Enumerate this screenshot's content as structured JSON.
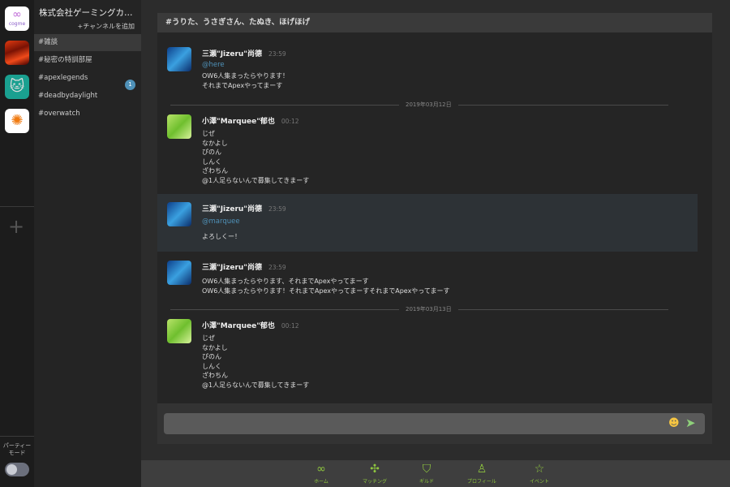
{
  "guild": {
    "name": "株式会社ゲーミングカ…",
    "add_channel": "+チャンネルを追加"
  },
  "channels": [
    {
      "label": "#雑談",
      "active": true
    },
    {
      "label": "#秘密の特訓部屋"
    },
    {
      "label": "#apexlegends",
      "badge": "1"
    },
    {
      "label": "#deadbydaylight"
    },
    {
      "label": "#overwatch"
    }
  ],
  "servers": [
    "cogme",
    "fire",
    "cat",
    "flower"
  ],
  "server_logo_text": "cogme",
  "party_mode": {
    "label": "パーティー\nモード",
    "on": false
  },
  "chat": {
    "title": "#うりた、うさぎさん、たぬき、ほげほげ",
    "messages": [
      {
        "author": "三瀬\"Jizeru\"尚德",
        "time": "23:59",
        "mention": "@here",
        "text": "OW6人集まったらやります！\nそれまでApexやってまーす"
      },
      {
        "date": "2019年03月12日"
      },
      {
        "author": "小澤\"Marquee\"郁也",
        "time": "00:12",
        "text": "じぜ\nなかよし\nぴのん\nしんく\nざわちん\n@1人足らないんで募集してきまーす"
      },
      {
        "author": "三瀬\"Jizeru\"尚德",
        "time": "23:59",
        "mention": "@marquee",
        "text": "よろしくー！",
        "highlighted": true
      },
      {
        "author": "三瀬\"Jizeru\"尚德",
        "time": "23:59",
        "text": "OW6人集まったらやります、それまでApexやってまーす\nOW6人集まったらやります！それまでApexやってまーすそれまでApexやってまーす"
      },
      {
        "date": "2019年03月13日"
      },
      {
        "author": "小澤\"Marquee\"郁也",
        "time": "00:12",
        "text": "じぜ\nなかよし\nぴのん\nしんく\nざわちん\n@1人足らないんで募集してきまーす"
      }
    ],
    "input_placeholder": ""
  },
  "nav": [
    {
      "label": "ホーム",
      "icon": "infinity-icon"
    },
    {
      "label": "マッチング",
      "icon": "puzzle-icon"
    },
    {
      "label": "ギルド",
      "icon": "guild-icon"
    },
    {
      "label": "プロフィール",
      "icon": "person-icon"
    },
    {
      "label": "イベント",
      "icon": "star-icon"
    }
  ],
  "colors": {
    "accent": "#8fc63f",
    "mention": "#4f91b8"
  }
}
